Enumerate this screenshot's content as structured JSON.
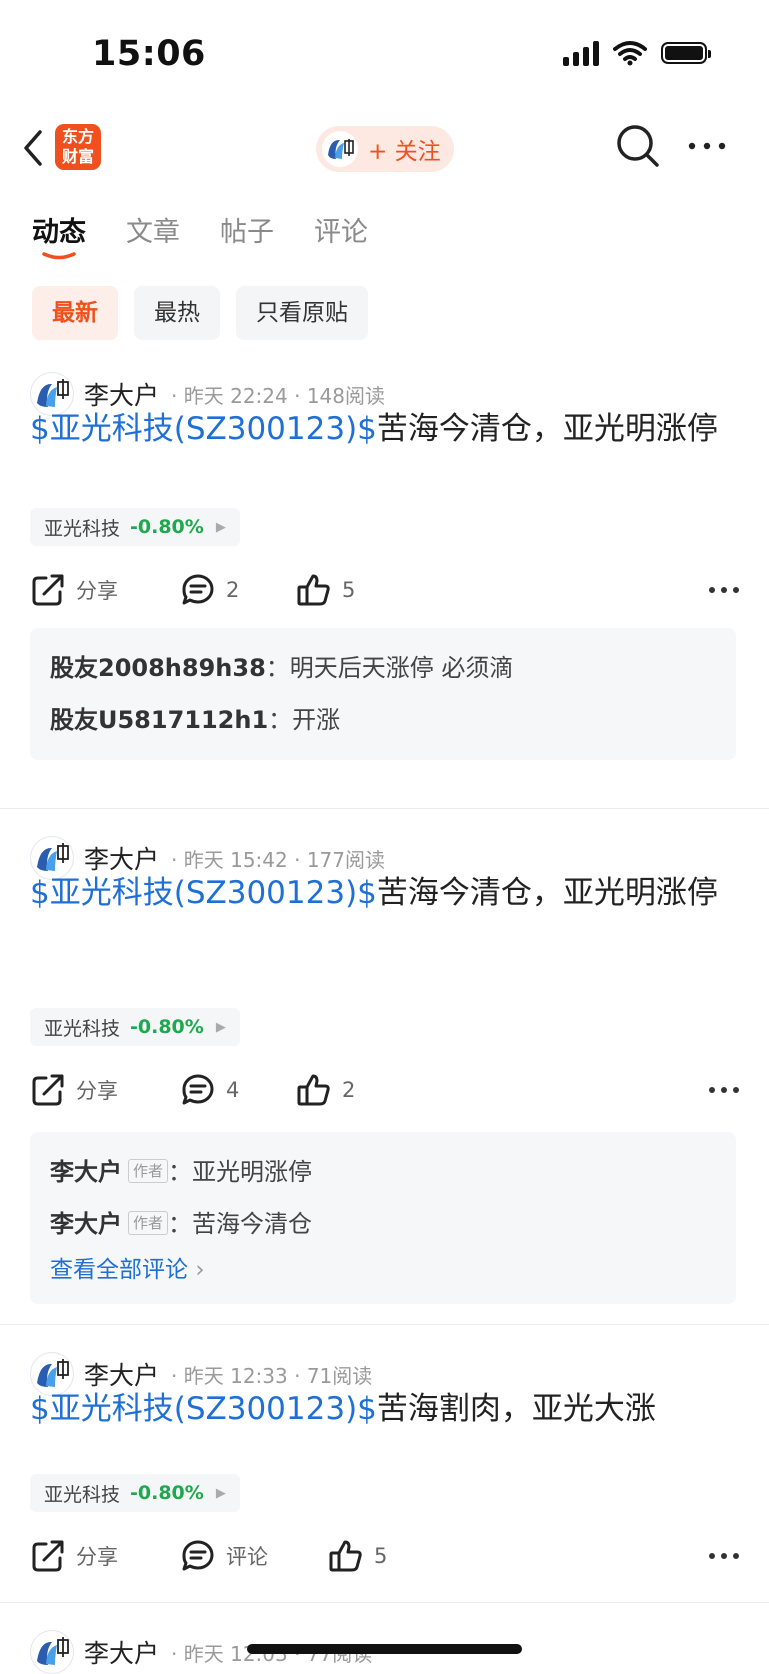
{
  "status_bar": {
    "time": "15:06"
  },
  "nav": {
    "logo_line1": "东方",
    "logo_line2": "财富",
    "follow_label": "+ 关注"
  },
  "tabs": [
    {
      "label": "动态"
    },
    {
      "label": "文章"
    },
    {
      "label": "帖子"
    },
    {
      "label": "评论"
    }
  ],
  "filters": [
    {
      "label": "最新"
    },
    {
      "label": "最热"
    },
    {
      "label": "只看原贴"
    }
  ],
  "posts": [
    {
      "user": "李大户",
      "time": "昨天 22:24",
      "reads": "148阅读",
      "stock_ref": "$亚光科技(SZ300123)$",
      "text": "苦海今清仓，亚光明涨停",
      "tag_name": "亚光科技",
      "tag_change": "-0.80%",
      "share_label": "分享",
      "comment_label": "2",
      "like_label": "5",
      "comments": [
        {
          "name": "股友2008h89h38",
          "sep": "：",
          "text": "明天后天涨停 必须滴"
        },
        {
          "name": "股友U5817112h1",
          "sep": "：",
          "text": "开涨"
        }
      ]
    },
    {
      "user": "李大户",
      "time": "昨天 15:42",
      "reads": "177阅读",
      "stock_ref": "$亚光科技(SZ300123)$",
      "text": "苦海今清仓，亚光明涨停",
      "tag_name": "亚光科技",
      "tag_change": "-0.80%",
      "share_label": "分享",
      "comment_label": "4",
      "like_label": "2",
      "comments": [
        {
          "name": "李大户",
          "badge": "作者",
          "sep": "：",
          "text": "亚光明涨停"
        },
        {
          "name": "李大户",
          "badge": "作者",
          "sep": "：",
          "text": "苦海今清仓"
        }
      ],
      "view_all": "查看全部评论"
    },
    {
      "user": "李大户",
      "time": "昨天 12:33",
      "reads": "71阅读",
      "stock_ref": "$亚光科技(SZ300123)$",
      "text": "苦海割肉，亚光大涨",
      "tag_name": "亚光科技",
      "tag_change": "-0.80%",
      "share_label": "分享",
      "comment_label": "评论",
      "like_label": "5"
    },
    {
      "user": "李大户",
      "time": "昨天 12:03",
      "reads": "77阅读"
    }
  ],
  "colors": {
    "accent": "#f0501e",
    "link": "#1e6fd6",
    "down": "#1fa84e"
  }
}
